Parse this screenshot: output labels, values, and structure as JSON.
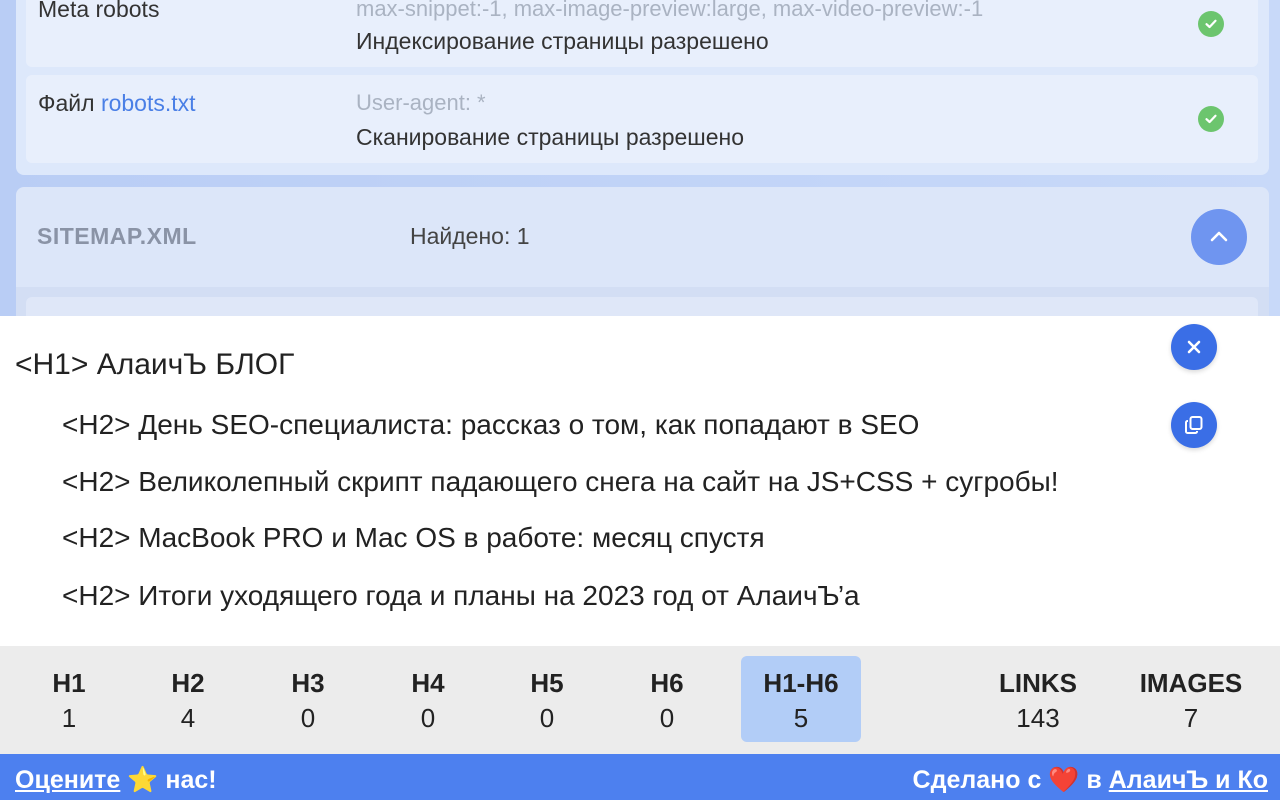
{
  "background": {
    "meta_robots": {
      "label": "Meta robots",
      "value": "max-snippet:-1, max-image-preview:large, max-video-preview:-1",
      "status": "Индексирование страницы разрешено"
    },
    "robots_file": {
      "label_prefix": "Файл",
      "label_link": "robots.txt",
      "value": "User-agent: *",
      "status": "Сканирование страницы разрешено"
    },
    "sitemap": {
      "title": "SITEMAP.XML",
      "count": "Найдено: 1"
    }
  },
  "headings": {
    "h1": "<H1> АлаичЪ БЛОГ",
    "h2": [
      "<H2> День SEO-специалиста: рассказ о том, как попадают в SEO",
      "<H2> Великолепный скрипт падающего снега на сайт на JS+CSS + сугробы!",
      "<H2> MacBook PRO и Mac OS в работе: месяц спустя",
      "<H2> Итоги уходящего года и планы на 2023 год от АлаичЪ’а"
    ]
  },
  "stats": [
    {
      "key": "H1",
      "value": "1"
    },
    {
      "key": "H2",
      "value": "4"
    },
    {
      "key": "H3",
      "value": "0"
    },
    {
      "key": "H4",
      "value": "0"
    },
    {
      "key": "H5",
      "value": "0"
    },
    {
      "key": "H6",
      "value": "0"
    },
    {
      "key": "H1-H6",
      "value": "5"
    },
    {
      "key": "LINKS",
      "value": "143"
    },
    {
      "key": "IMAGES",
      "value": "7"
    }
  ],
  "footer": {
    "rate_link": "Оцените",
    "rate_star": "⭐",
    "rate_suffix": "нас!",
    "made_prefix": "Сделано с",
    "made_heart": "❤️",
    "made_in": "в",
    "made_link": "АлаичЪ и Ко"
  },
  "colors": {
    "accent": "#3a6ee6",
    "footer": "#4d80ef",
    "active_stat": "#b2cdf7",
    "check": "#6cc56e"
  },
  "icons": [
    "check-icon",
    "chevron-up-icon",
    "close-icon",
    "copy-icon",
    "star-icon",
    "heart-icon"
  ]
}
